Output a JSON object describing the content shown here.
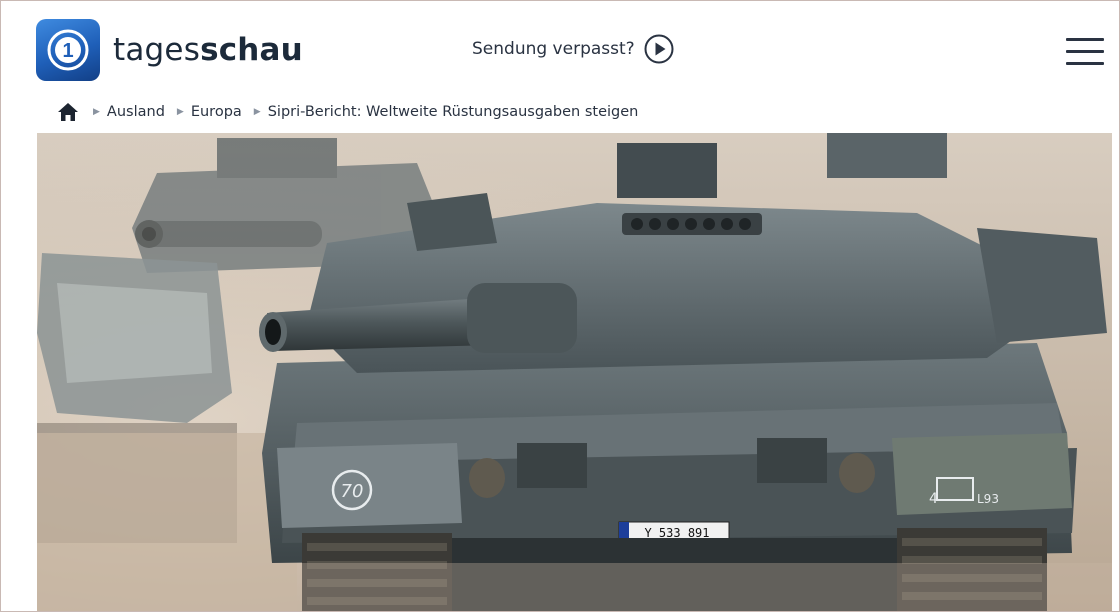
{
  "site": {
    "logo_text_regular": "tages",
    "logo_text_bold": "schau",
    "logo_badge_glyph": "1"
  },
  "header": {
    "sendung_label": "Sendung verpasst?",
    "menu_icon": "hamburger-menu-icon"
  },
  "breadcrumb": {
    "home_icon": "home-icon",
    "items": [
      "Ausland",
      "Europa",
      "Sipri-Bericht: Weltweite Rüstungsausgaben steigen"
    ]
  },
  "hero": {
    "turret_number": "70",
    "plate_text": "Y 533 891",
    "side_marking": "4",
    "side_marking_2": "L93"
  },
  "colors": {
    "brand_blue": "#1f5fb8",
    "text_dark": "#2a3342",
    "tank_grey": "#5a6468",
    "dust": "#c9b8a6"
  }
}
